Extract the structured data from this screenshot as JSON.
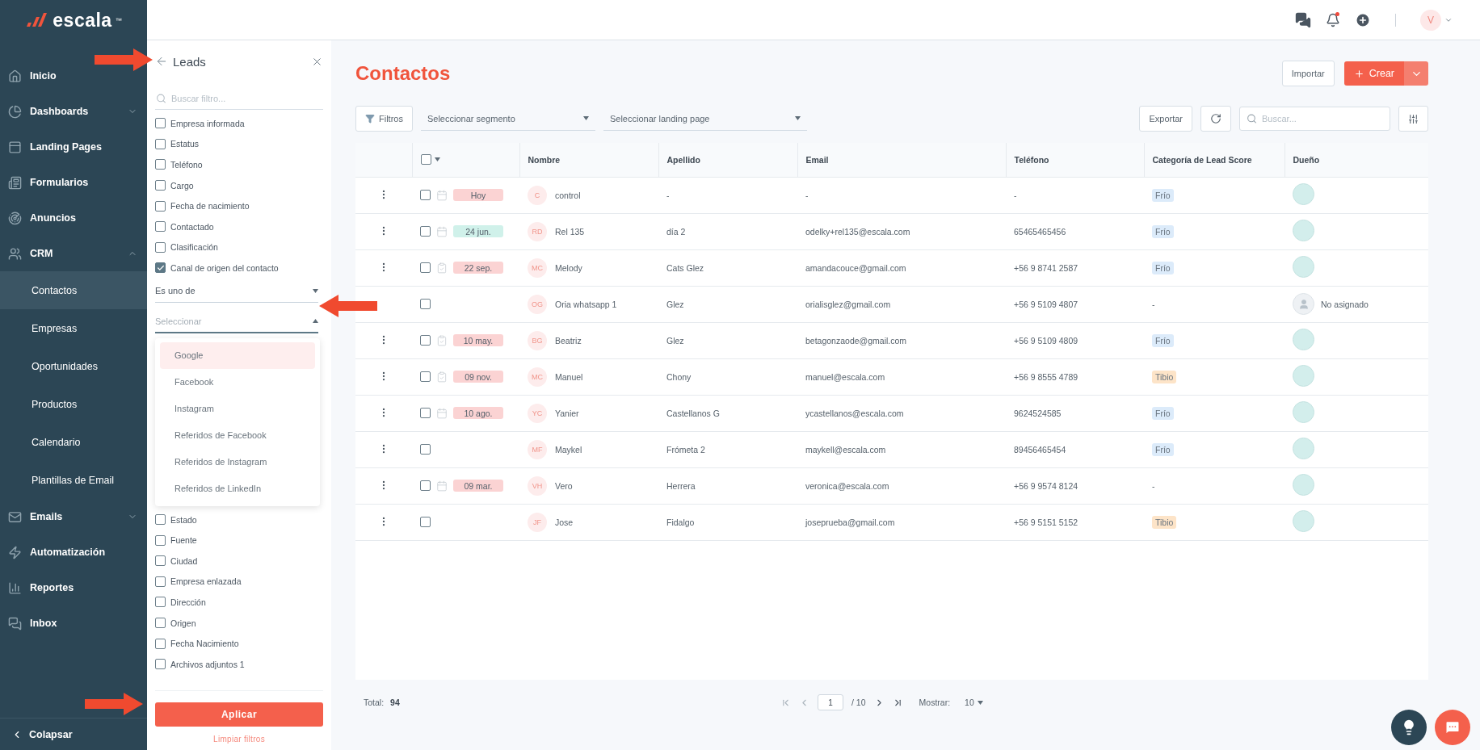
{
  "brand": {
    "name": "escala",
    "mark": "™"
  },
  "sidebar": {
    "items": [
      {
        "label": "Inicio",
        "selected": false
      },
      {
        "label": "Dashboards",
        "selected": false,
        "expanded": false
      },
      {
        "label": "Landing Pages",
        "selected": false
      },
      {
        "label": "Formularios",
        "selected": false
      },
      {
        "label": "Anuncios",
        "selected": false
      },
      {
        "label": "CRM",
        "selected": false,
        "expanded": true,
        "children": [
          {
            "label": "Contactos",
            "selected": true
          },
          {
            "label": "Empresas",
            "selected": false
          },
          {
            "label": "Oportunidades",
            "selected": false
          },
          {
            "label": "Productos",
            "selected": false
          },
          {
            "label": "Calendario",
            "selected": false
          },
          {
            "label": "Plantillas de Email",
            "selected": false
          }
        ]
      },
      {
        "label": "Emails",
        "selected": false,
        "expanded": false
      },
      {
        "label": "Automatización",
        "selected": false
      },
      {
        "label": "Reportes",
        "selected": false
      },
      {
        "label": "Inbox",
        "selected": false
      }
    ],
    "collapse": "Colapsar"
  },
  "topbar": {
    "notifications_unread": true,
    "avatar": "V"
  },
  "filter_panel": {
    "title": "Leads",
    "search": {
      "placeholder": "Buscar filtro..."
    },
    "filters": [
      {
        "label": "Empresa informada",
        "checked": false
      },
      {
        "label": "Estatus",
        "checked": false
      },
      {
        "label": "Teléfono",
        "checked": false
      },
      {
        "label": "Cargo",
        "checked": false
      },
      {
        "label": "Fecha de nacimiento",
        "checked": false
      },
      {
        "label": "Contactado",
        "checked": false
      },
      {
        "label": "Clasificación",
        "checked": false
      },
      {
        "label": "Canal de origen del contacto",
        "checked": true,
        "condition": {
          "operator": "Es uno de",
          "value": {
            "placeholder": "Seleccionar",
            "expanded": true
          },
          "options": [
            {
              "label": "Google",
              "selected": true
            },
            {
              "label": "Facebook",
              "selected": false
            },
            {
              "label": "Instagram",
              "selected": false
            },
            {
              "label": "Referidos de Facebook",
              "selected": false
            },
            {
              "label": "Referidos de Instagram",
              "selected": false
            },
            {
              "label": "Referidos de LinkedIn",
              "selected": false
            }
          ]
        }
      },
      {
        "label": "Estado",
        "checked": false
      },
      {
        "label": "Fuente",
        "checked": false
      },
      {
        "label": "Ciudad",
        "checked": false
      },
      {
        "label": "Empresa enlazada",
        "checked": false
      },
      {
        "label": "Dirección",
        "checked": false
      },
      {
        "label": "Origen",
        "checked": false
      },
      {
        "label": "Fecha Nacimiento",
        "checked": false
      },
      {
        "label": "Archivos adjuntos 1",
        "checked": false
      }
    ],
    "apply": "Aplicar",
    "clear": "Limpiar filtros"
  },
  "annotations": [
    {
      "kind": "right-arrow"
    },
    {
      "kind": "left-arrow"
    },
    {
      "kind": "right-arrow"
    }
  ],
  "page": {
    "title": "Contactos",
    "import": "Importar",
    "create": "Crear"
  },
  "toolbar": {
    "filters": "Filtros",
    "segment": {
      "placeholder": "Seleccionar segmento"
    },
    "landing": {
      "placeholder": "Seleccionar landing page"
    },
    "export": "Exportar",
    "search": {
      "placeholder": "Buscar..."
    }
  },
  "table": {
    "select_all": {
      "checked": false
    },
    "columns": [
      "Nombre",
      "Apellido",
      "Email",
      "Teléfono",
      "Categoría de Lead Score",
      "Dueño"
    ],
    "rows": [
      {
        "menu": true,
        "checked": false,
        "task": {
          "kind": "calendar",
          "date": "Hoy",
          "color": "#fbd3d3"
        },
        "initials": "C",
        "name": "control",
        "surname": "-",
        "email": "-",
        "phone": "-",
        "score": {
          "label": "Frío",
          "color": "#dcebfa"
        },
        "owner": {
          "kind": "avatar"
        }
      },
      {
        "menu": true,
        "checked": false,
        "task": {
          "kind": "calendar",
          "date": "24 jun.",
          "color": "#d0f1ea"
        },
        "initials": "RD",
        "name": "Rel 135",
        "surname": "día 2",
        "email": "odelky+rel135@escala.com",
        "phone": "65465465456",
        "score": {
          "label": "Frío",
          "color": "#dcebfa"
        },
        "owner": {
          "kind": "avatar"
        }
      },
      {
        "menu": true,
        "checked": false,
        "task": {
          "kind": "clipboard",
          "date": "22 sep.",
          "color": "#fbd3d3"
        },
        "initials": "MC",
        "name": "Melody",
        "surname": "Cats Glez",
        "email": "amandacouce@gmail.com",
        "phone": "+56 9 8741 2587",
        "score": {
          "label": "Frío",
          "color": "#dcebfa"
        },
        "owner": {
          "kind": "avatar"
        }
      },
      {
        "menu": false,
        "checked": false,
        "initials": "OG",
        "name": "Oria whatsapp 1",
        "surname": "Glez",
        "email": "orialisglez@gmail.com",
        "phone": "+56 9 5109 4807",
        "score": {
          "label": "-"
        },
        "owner": {
          "kind": "unassigned",
          "label": "No asignado"
        }
      },
      {
        "menu": true,
        "checked": false,
        "task": {
          "kind": "clipboard",
          "date": "10 may.",
          "color": "#fbd3d3"
        },
        "initials": "BG",
        "name": "Beatriz",
        "surname": "Glez",
        "email": "betagonzaode@gmail.com",
        "phone": "+56 9 5109 4809",
        "score": {
          "label": "Frío",
          "color": "#dcebfa"
        },
        "owner": {
          "kind": "avatar"
        }
      },
      {
        "menu": true,
        "checked": false,
        "task": {
          "kind": "clipboard",
          "date": "09 nov.",
          "color": "#fbd3d3"
        },
        "initials": "MC",
        "name": "Manuel",
        "surname": "Chony",
        "email": "manuel@escala.com",
        "phone": "+56 9 8555 4789",
        "score": {
          "label": "Tibio",
          "color": "#fde4c8"
        },
        "owner": {
          "kind": "avatar"
        }
      },
      {
        "menu": true,
        "checked": false,
        "task": {
          "kind": "calendar",
          "date": "10 ago.",
          "color": "#fbd3d3"
        },
        "initials": "YC",
        "name": "Yanier",
        "surname": "Castellanos G",
        "email": "ycastellanos@escala.com",
        "phone": "9624524585",
        "score": {
          "label": "Frío",
          "color": "#dcebfa"
        },
        "owner": {
          "kind": "avatar"
        }
      },
      {
        "menu": true,
        "checked": false,
        "initials": "MF",
        "name": "Maykel",
        "surname": "Frómeta 2",
        "email": "maykell@escala.com",
        "phone": "89456465454",
        "score": {
          "label": "Frío",
          "color": "#dcebfa"
        },
        "owner": {
          "kind": "avatar"
        }
      },
      {
        "menu": true,
        "checked": false,
        "task": {
          "kind": "calendar",
          "date": "09 mar.",
          "color": "#fbd3d3"
        },
        "initials": "VH",
        "name": "Vero",
        "surname": "Herrera",
        "email": "veronica@escala.com",
        "phone": "+56 9 9574 8124",
        "score": {
          "label": "-"
        },
        "owner": {
          "kind": "avatar"
        }
      },
      {
        "menu": true,
        "checked": false,
        "initials": "JF",
        "name": "Jose",
        "surname": "Fidalgo",
        "email": "joseprueba@gmail.com",
        "phone": "+56 9 5151 5152",
        "score": {
          "label": "Tibio",
          "color": "#fde4c8"
        },
        "owner": {
          "kind": "avatar"
        }
      }
    ]
  },
  "footer": {
    "total_label": "Total:",
    "total": "94",
    "page": "1",
    "pages": "/ 10",
    "show_label": "Mostrar:",
    "show": "10"
  }
}
